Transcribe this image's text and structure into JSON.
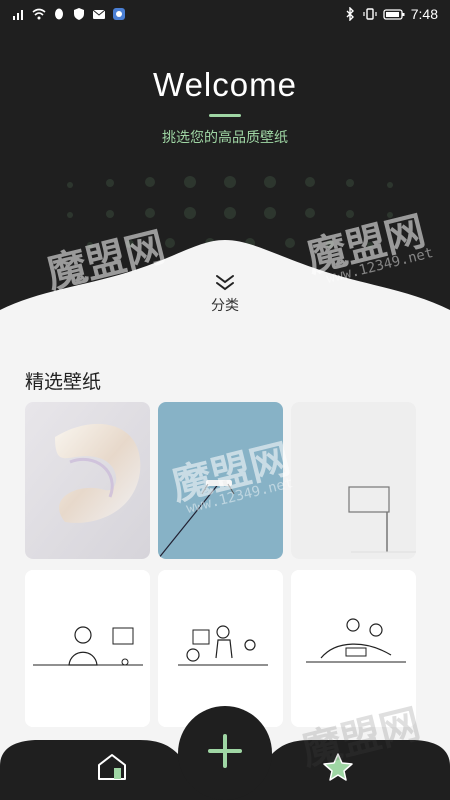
{
  "status_bar": {
    "time": "7:48"
  },
  "hero": {
    "title": "Welcome",
    "subtitle": "挑选您的高品质壁纸",
    "accent_color": "#9fd6a4",
    "background_color": "#1f1f1f"
  },
  "category": {
    "label": "分类",
    "icon": "double-chevron-down-icon"
  },
  "featured": {
    "title": "精选壁纸",
    "wallpapers": [
      {
        "subject": "iridescent folded glass ribbon"
      },
      {
        "subject": "drone above a cable against blue sky"
      },
      {
        "subject": "basketball hoop on white wall"
      },
      {
        "subject": "line drawing: person reading at desk"
      },
      {
        "subject": "line drawing: people playing with toys"
      },
      {
        "subject": "line drawing: people resting with books"
      }
    ]
  },
  "bottom_nav": {
    "home_icon": "home-icon",
    "add_icon": "plus-icon",
    "favorites_icon": "star-icon"
  },
  "watermark": {
    "brand": "魔盟网",
    "url": "www.12349.net"
  }
}
